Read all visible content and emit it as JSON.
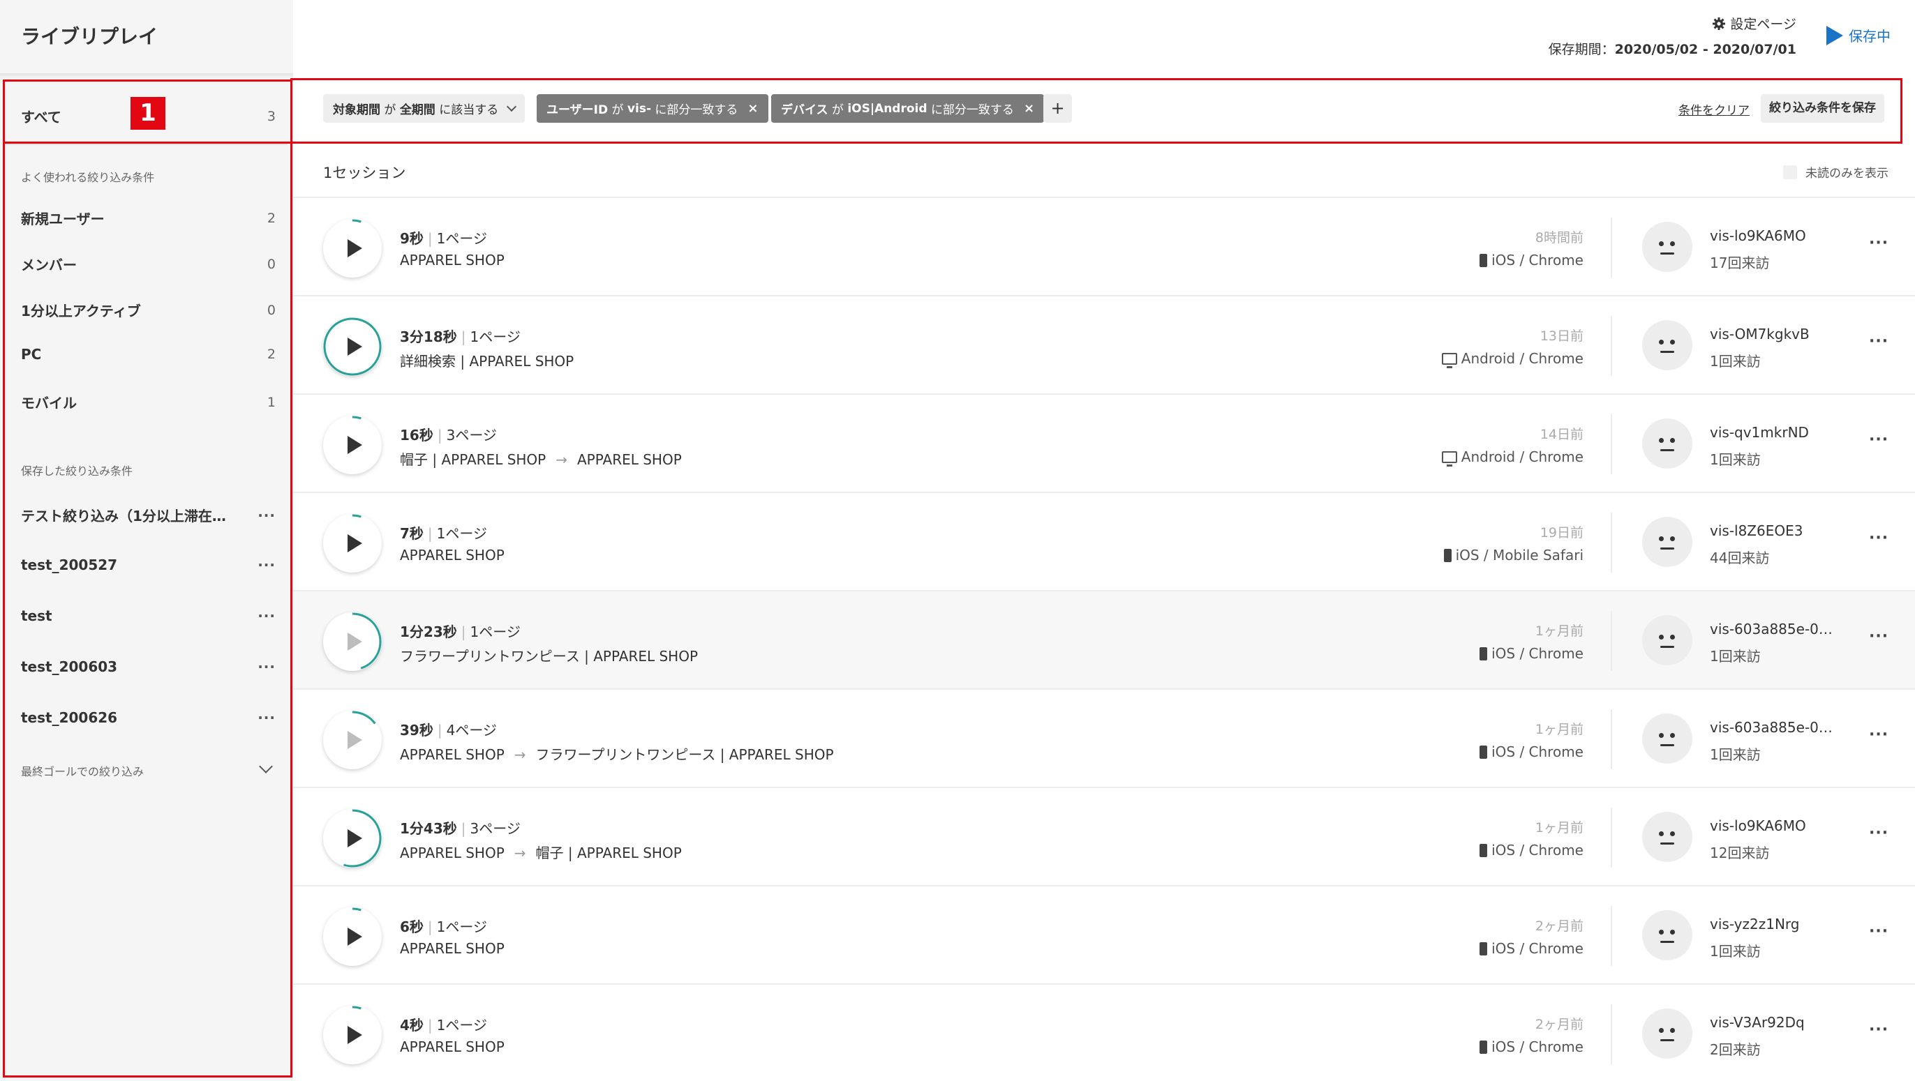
{
  "app": {
    "title": "ライブリプレイ"
  },
  "header": {
    "settings_label": "設定ページ",
    "period_label": "保存期間：",
    "period_value": "2020/05/02 - 2020/07/01",
    "saving_label": "保存中"
  },
  "sidebar": {
    "all": {
      "label": "すべて",
      "count": "3"
    },
    "badge": "1",
    "frequent_heading": "よく使われる絞り込み条件",
    "frequent": [
      {
        "label": "新規ユーザー",
        "count": "2"
      },
      {
        "label": "メンバー",
        "count": "0"
      },
      {
        "label": "1分以上アクティブ",
        "count": "0"
      },
      {
        "label": "PC",
        "count": "2"
      },
      {
        "label": "モバイル",
        "count": "1"
      }
    ],
    "saved_heading": "保存した絞り込み条件",
    "saved": [
      {
        "label": "テスト絞り込み（1分以上滞在…",
        "menu": "···"
      },
      {
        "label": "test_200527",
        "menu": "···"
      },
      {
        "label": "test",
        "menu": "···"
      },
      {
        "label": "test_200603",
        "menu": "···"
      },
      {
        "label": "test_200626",
        "menu": "···"
      }
    ],
    "goal_heading": "最終ゴールでの絞り込み"
  },
  "filters": {
    "chips": [
      {
        "field": "対象期間",
        "op1": "が",
        "value": "全期間",
        "op2": "に該当する",
        "kind": "dropdown"
      },
      {
        "field": "ユーザーID",
        "op1": "が",
        "value": "vis-",
        "op2": "に部分一致する",
        "kind": "remove",
        "remove": "×"
      },
      {
        "field": "デバイス",
        "op1": "が",
        "value": "iOS|Android",
        "op2": "に部分一致する",
        "kind": "remove",
        "remove": "×"
      }
    ],
    "add": "+",
    "clear": "条件をクリア",
    "save": "絞り込み条件を保存"
  },
  "list": {
    "count_label": "1セッション",
    "unread_only": "未読のみを表示",
    "sessions": [
      {
        "duration": "9秒",
        "pages": "1ページ",
        "path": [
          "APPAREL SHOP"
        ],
        "ago": "8時間前",
        "device": "iOS / Chrome",
        "device_icon": "phone-icon",
        "visitor": "vis-lo9KA6MO",
        "visits": "17回来訪",
        "progress": 0.05,
        "played": false
      },
      {
        "duration": "3分18秒",
        "pages": "1ページ",
        "path": [
          "詳細検索 | APPAREL SHOP"
        ],
        "ago": "13日前",
        "device": "Android / Chrome",
        "device_icon": "monitor-icon",
        "visitor": "vis-OM7kgkvB",
        "visits": "1回来訪",
        "progress": 1.0,
        "played": false
      },
      {
        "duration": "16秒",
        "pages": "3ページ",
        "path": [
          "帽子 | APPAREL SHOP",
          "APPAREL SHOP"
        ],
        "ago": "14日前",
        "device": "Android / Chrome",
        "device_icon": "monitor-icon",
        "visitor": "vis-qv1mkrND",
        "visits": "1回来訪",
        "progress": 0.05,
        "played": false
      },
      {
        "duration": "7秒",
        "pages": "1ページ",
        "path": [
          "APPAREL SHOP"
        ],
        "ago": "19日前",
        "device": "iOS / Mobile Safari",
        "device_icon": "phone-icon",
        "visitor": "vis-l8Z6EOE3",
        "visits": "44回来訪",
        "progress": 0.05,
        "played": false
      },
      {
        "duration": "1分23秒",
        "pages": "1ページ",
        "path": [
          "フラワープリントワンピース | APPAREL SHOP"
        ],
        "ago": "1ヶ月前",
        "device": "iOS / Chrome",
        "device_icon": "phone-icon",
        "visitor": "vis-603a885e-07…",
        "visits": "1回来訪",
        "progress": 0.45,
        "played": true
      },
      {
        "duration": "39秒",
        "pages": "4ページ",
        "path": [
          "APPAREL SHOP",
          "フラワープリントワンピース | APPAREL SHOP"
        ],
        "ago": "1ヶ月前",
        "device": "iOS / Chrome",
        "device_icon": "phone-icon",
        "visitor": "vis-603a885e-07…",
        "visits": "1回来訪",
        "progress": 0.15,
        "played": true
      },
      {
        "duration": "1分43秒",
        "pages": "3ページ",
        "path": [
          "APPAREL SHOP",
          "帽子 | APPAREL SHOP"
        ],
        "ago": "1ヶ月前",
        "device": "iOS / Chrome",
        "device_icon": "phone-icon",
        "visitor": "vis-lo9KA6MO",
        "visits": "12回来訪",
        "progress": 0.55,
        "played": false
      },
      {
        "duration": "6秒",
        "pages": "1ページ",
        "path": [
          "APPAREL SHOP"
        ],
        "ago": "2ヶ月前",
        "device": "iOS / Chrome",
        "device_icon": "phone-icon",
        "visitor": "vis-yz2z1Nrg",
        "visits": "1回来訪",
        "progress": 0.05,
        "played": false
      },
      {
        "duration": "4秒",
        "pages": "1ページ",
        "path": [
          "APPAREL SHOP"
        ],
        "ago": "2ヶ月前",
        "device": "iOS / Chrome",
        "device_icon": "phone-icon",
        "visitor": "vis-V3Ar92Dq",
        "visits": "2回来訪",
        "progress": 0.05,
        "played": false
      }
    ],
    "row_menu": "···"
  },
  "colors": {
    "highlight": "#e30613",
    "accent": "#1a73c8",
    "progress": "#2aa198"
  }
}
